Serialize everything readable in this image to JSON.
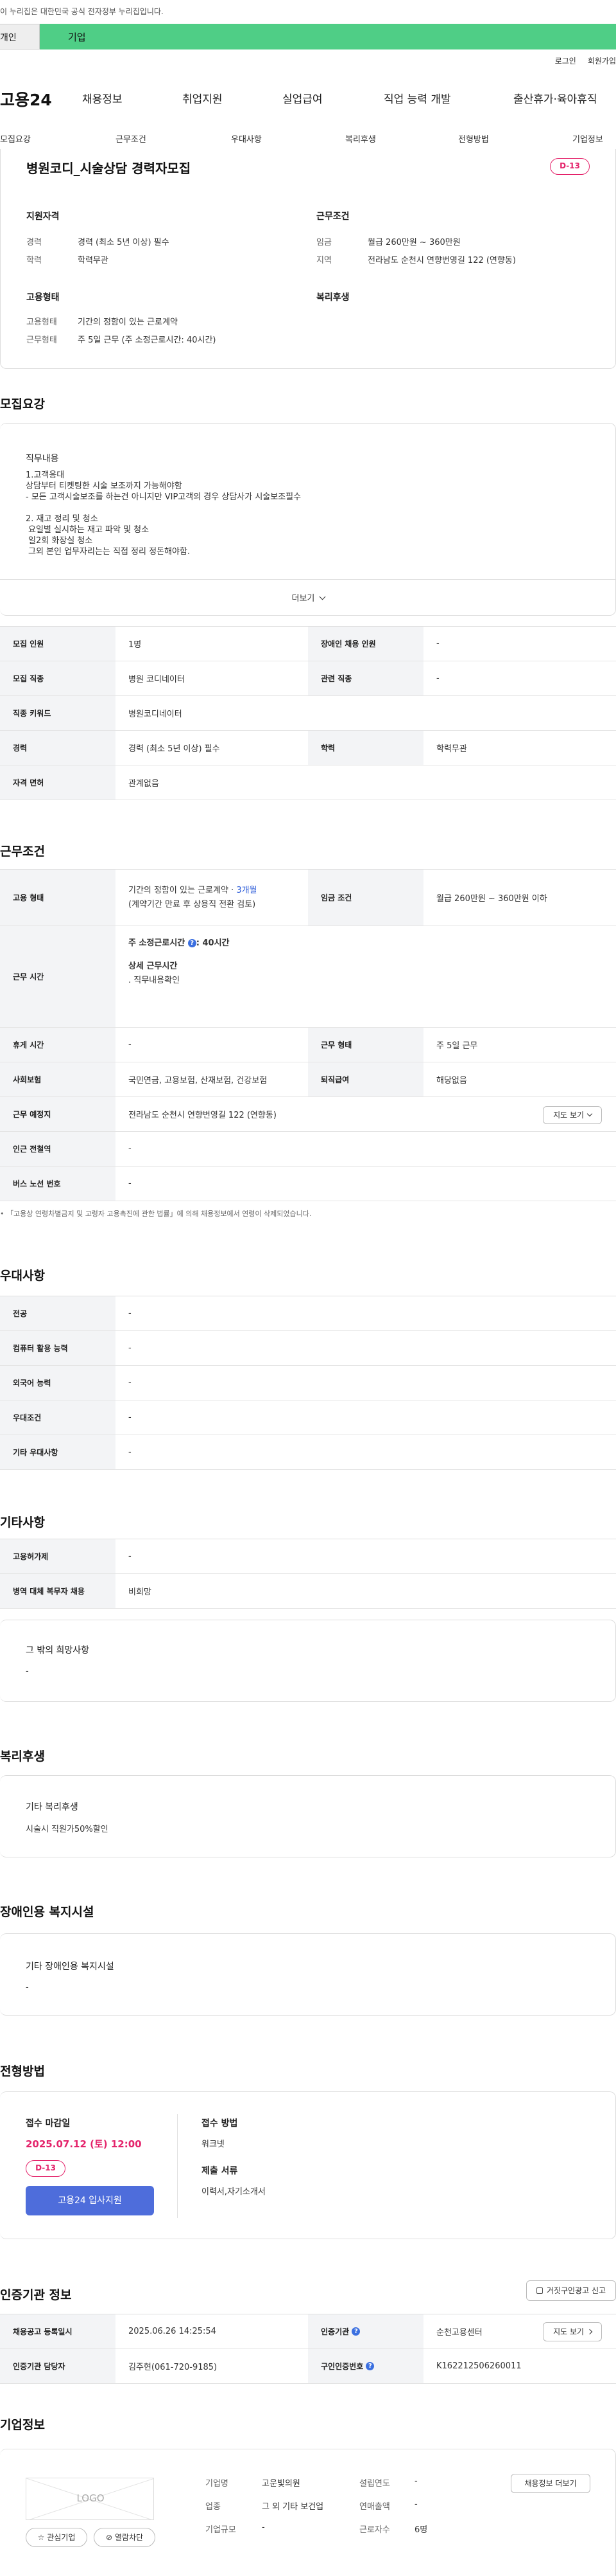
{
  "notice": "이 누리집은 대한민국 공식 전자정부 누리집입니다.",
  "user_tabs": {
    "personal": "개인",
    "corporate": "기업"
  },
  "util": {
    "login": "로그인",
    "join": "회원가입"
  },
  "logo": "고용24",
  "gnb": [
    "채용정보",
    "취업지원",
    "실업급여",
    "직업 능력 개발",
    "출산휴가·육아휴직"
  ],
  "lnb": [
    "모집요강",
    "근무조건",
    "우대사항",
    "복리후생",
    "전형방법",
    "기업정보"
  ],
  "job": {
    "title": "병원코디_시술상담 경력자모집",
    "dday": "D-13",
    "qualification": {
      "heading": "지원자격",
      "career_label": "경력",
      "career_value": "경력 (최소 5년 이상) 필수",
      "edu_label": "학력",
      "edu_value": "학력무관"
    },
    "conditions": {
      "heading": "근무조건",
      "wage_label": "임금",
      "wage_value": "월급 260만원 ~ 360만원",
      "region_label": "지역",
      "region_value": "전라남도 순천시 연향번영길 122 (연향동)"
    },
    "employment": {
      "heading": "고용형태",
      "type_label": "고용형태",
      "type_value": "기간의 정함이 있는 근로계약",
      "work_label": "근무형태",
      "work_value": "주 5일 근무 (주 소정근로시간: 40시간)"
    },
    "welfare_heading": "복리후생"
  },
  "recruit": {
    "heading": "모집요강",
    "duty_heading": "직무내용",
    "duty_lines": [
      "1.고객응대",
      "상담부터 티켓팅한 시술 보조까지 가능해야함",
      "- 모든 고객시술보조를 하는건 아니지만 VIP고객의 경우 상담사가 시술보조필수",
      "",
      "2. 재고 정리 및 청소",
      "요일별 실시하는 재고 파악 및 청소",
      "일2회 화장실 청소",
      "그외 본인 업무자리는는 직접 정리 정돈해야함."
    ],
    "more": "더보기",
    "rows": [
      {
        "l1": "모집 인원",
        "v1": "1명",
        "l2": "장애인 채용 인원",
        "v2": "-"
      },
      {
        "l1": "모집 직종",
        "v1": "병원 코디네이터",
        "l2": "관련 직종",
        "v2": "-"
      },
      {
        "l1": "직종 키워드",
        "v1": "병원코디네이터"
      },
      {
        "l1": "경력",
        "v1": "경력 (최소 5년 이상) 필수",
        "l2": "학력",
        "v2": "학력무관"
      },
      {
        "l1": "자격 면허",
        "v1": "관계없음"
      }
    ]
  },
  "work": {
    "heading": "근무조건",
    "emp_label": "고용 형태",
    "emp_value": "기간의 정함이 있는 근로계약 · ",
    "emp_months": "3개월",
    "emp_note": "(계약기간 만료 후 상용직 전환 검토)",
    "wage_label": "임금 조건",
    "wage_value": "월급 260만원 ~ 360만원 이하",
    "time_label": "근무 시간",
    "time_main_a": "주 소정근로시간 ",
    "time_main_b": ": 40시간",
    "time_detail_title": "상세 근무시간",
    "time_detail": ". 직무내용확인",
    "rest_label": "휴게 시간",
    "rest_value": "-",
    "form_label": "근무 형태",
    "form_value": "주 5일 근무",
    "ins_label": "사회보험",
    "ins_value": "국민연금, 고용보험, 산재보험, 건강보험",
    "sev_label": "퇴직급여",
    "sev_value": "해당없음",
    "place_label": "근무 예정지",
    "place_value": "전라남도 순천시 연향번영길 122 (연향동)",
    "map_btn": "지도 보기",
    "subway_label": "인근 전철역",
    "subway_value": "-",
    "bus_label": "버스 노선 번호",
    "bus_value": "-",
    "footnote": "「고용상 연령차별금지 및 고령자 고용촉진에 관한 법률」에 의해 채용정보에서 연령이 삭제되었습니다."
  },
  "pref": {
    "heading": "우대사항",
    "rows": [
      {
        "label": "전공",
        "value": "-"
      },
      {
        "label": "컴퓨터 활용 능력",
        "value": "-"
      },
      {
        "label": "외국어 능력",
        "value": "-"
      },
      {
        "label": "우대조건",
        "value": "-"
      },
      {
        "label": "기타 우대사항",
        "value": "-"
      }
    ]
  },
  "etc": {
    "heading": "기타사항",
    "rows": [
      {
        "label": "고용허가제",
        "value": "-"
      },
      {
        "label": "병역 대체 복무자 채용",
        "value": "비희망"
      }
    ],
    "other_heading": "그 밖의 희망사항",
    "other_value": "-"
  },
  "welfare": {
    "heading": "복리후생",
    "sub": "기타 복리후생",
    "value": "시술시 직원가50%할인"
  },
  "disability": {
    "heading": "장애인용 복지시설",
    "sub": "기타 장애인용 복지시설",
    "value": "-"
  },
  "process": {
    "heading": "전형방법",
    "deadline_title": "접수 마감일",
    "deadline": "2025.07.12 (토) 12:00",
    "dday": "D-13",
    "apply_btn": "고용24 입사지원",
    "method_title": "접수 방법",
    "method": "워크넷",
    "docs_title": "제출 서류",
    "docs": "이력서,자기소개서"
  },
  "cert": {
    "heading": "인증기관 정보",
    "report_btn": "거짓구인광고 신고",
    "reg_label": "채용공고 등록일시",
    "reg_value": "2025.06.26 14:25:54",
    "org_label": "인증기관",
    "org_value": "순천고용센터",
    "map_btn": "지도 보기",
    "manager_label": "인증기관 담당자",
    "manager_value": "김주현(061-720-9185)",
    "num_label": "구인인증번호",
    "num_value": "K162212506260011"
  },
  "company": {
    "heading": "기업정보",
    "logo_text": "LOGO",
    "fav_btn": "관심기업",
    "block_btn": "열람차단",
    "jobs_btn": "채용정보 더보기",
    "name_label": "기업명",
    "name_value": "고운빛의원",
    "year_label": "설립연도",
    "year_value": "-",
    "ind_label": "업종",
    "ind_value": "그 외 기타 보건업",
    "sales_label": "연매출액",
    "sales_value": "-",
    "size_label": "기업규모",
    "size_value": "-",
    "emp_label": "근로자수",
    "emp_value": "6명"
  }
}
